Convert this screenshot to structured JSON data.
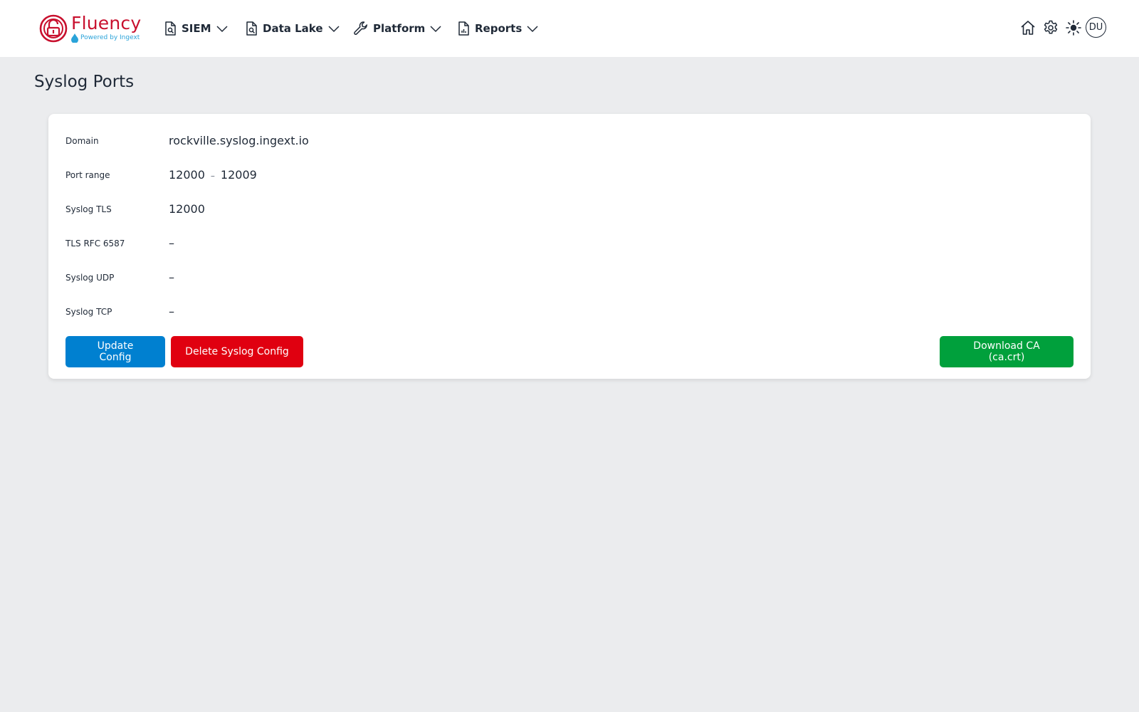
{
  "brand": {
    "name": "Fluency",
    "tagline": "Powered by Ingext",
    "primary_color": "#c8102e",
    "tagline_color": "#2aa3d9"
  },
  "nav": {
    "items": [
      {
        "label": "SIEM",
        "icon": "document-search-icon"
      },
      {
        "label": "Data Lake",
        "icon": "document-search-icon"
      },
      {
        "label": "Platform",
        "icon": "wrench-icon"
      },
      {
        "label": "Reports",
        "icon": "document-chart-icon"
      }
    ]
  },
  "header_actions": {
    "icons": [
      "home-icon",
      "gear-icon",
      "sun-icon"
    ],
    "avatar_initials": "DU"
  },
  "page": {
    "title": "Syslog Ports"
  },
  "config": {
    "domain_label": "Domain",
    "domain_value": "rockville.syslog.ingext.io",
    "port_range_label": "Port range",
    "port_range_start": "12000",
    "port_range_sep": "–",
    "port_range_end": "12009",
    "syslog_tls_label": "Syslog TLS",
    "syslog_tls_value": "12000",
    "tls_rfc_label": "TLS RFC 6587",
    "tls_rfc_value": "–",
    "syslog_udp_label": "Syslog UDP",
    "syslog_udp_value": "–",
    "syslog_tcp_label": "Syslog TCP",
    "syslog_tcp_value": "–"
  },
  "actions": {
    "update_label": "Update Config",
    "delete_label": "Delete Syslog Config",
    "download_label": "Download CA (ca.crt)",
    "update_color": "#0080d0",
    "delete_color": "#e00010",
    "download_color": "#00a03c"
  }
}
